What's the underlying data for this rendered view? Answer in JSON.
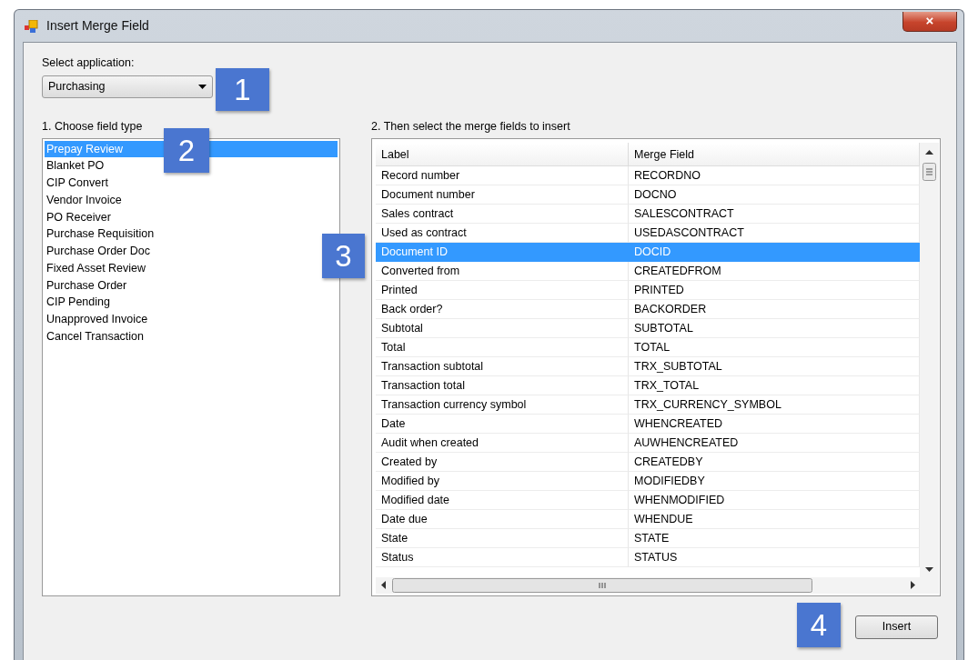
{
  "window": {
    "title": "Insert Merge Field",
    "close_label": "×"
  },
  "application": {
    "label": "Select application:",
    "value": "Purchasing"
  },
  "field_types": {
    "label": "1. Choose field type",
    "items": [
      {
        "label": "Prepay Review",
        "selected": true
      },
      {
        "label": "Blanket PO",
        "selected": false
      },
      {
        "label": "CIP Convert",
        "selected": false
      },
      {
        "label": "Vendor Invoice",
        "selected": false
      },
      {
        "label": "PO Receiver",
        "selected": false
      },
      {
        "label": "Purchase Requisition",
        "selected": false
      },
      {
        "label": "Purchase Order Doc",
        "selected": false
      },
      {
        "label": "Fixed Asset Review",
        "selected": false
      },
      {
        "label": "Purchase Order",
        "selected": false
      },
      {
        "label": "CIP Pending",
        "selected": false
      },
      {
        "label": "Unapproved Invoice",
        "selected": false
      },
      {
        "label": "Cancel Transaction",
        "selected": false
      }
    ]
  },
  "merge_fields": {
    "label": "2. Then select the merge fields to insert",
    "columns": [
      "Label",
      "Merge Field"
    ],
    "rows": [
      {
        "label": "Record number",
        "merge_field": "RECORDNO",
        "selected": false
      },
      {
        "label": "Document number",
        "merge_field": "DOCNO",
        "selected": false
      },
      {
        "label": "Sales contract",
        "merge_field": "SALESCONTRACT",
        "selected": false
      },
      {
        "label": "Used as contract",
        "merge_field": "USEDASCONTRACT",
        "selected": false
      },
      {
        "label": "Document ID",
        "merge_field": "DOCID",
        "selected": true
      },
      {
        "label": "Converted from",
        "merge_field": "CREATEDFROM",
        "selected": false
      },
      {
        "label": "Printed",
        "merge_field": "PRINTED",
        "selected": false
      },
      {
        "label": "Back order?",
        "merge_field": "BACKORDER",
        "selected": false
      },
      {
        "label": "Subtotal",
        "merge_field": "SUBTOTAL",
        "selected": false
      },
      {
        "label": "Total",
        "merge_field": "TOTAL",
        "selected": false
      },
      {
        "label": "Transaction subtotal",
        "merge_field": "TRX_SUBTOTAL",
        "selected": false
      },
      {
        "label": "Transaction total",
        "merge_field": "TRX_TOTAL",
        "selected": false
      },
      {
        "label": "Transaction currency symbol",
        "merge_field": "TRX_CURRENCY_SYMBOL",
        "selected": false
      },
      {
        "label": "Date",
        "merge_field": "WHENCREATED",
        "selected": false
      },
      {
        "label": "Audit when created",
        "merge_field": "AUWHENCREATED",
        "selected": false
      },
      {
        "label": "Created by",
        "merge_field": "CREATEDBY",
        "selected": false
      },
      {
        "label": "Modified by",
        "merge_field": "MODIFIEDBY",
        "selected": false
      },
      {
        "label": "Modified date",
        "merge_field": "WHENMODIFIED",
        "selected": false
      },
      {
        "label": "Date due",
        "merge_field": "WHENDUE",
        "selected": false
      },
      {
        "label": "State",
        "merge_field": "STATE",
        "selected": false
      },
      {
        "label": "Status",
        "merge_field": "STATUS",
        "selected": false
      }
    ]
  },
  "insert_button": "Insert",
  "callouts": [
    "1",
    "2",
    "3",
    "4"
  ]
}
